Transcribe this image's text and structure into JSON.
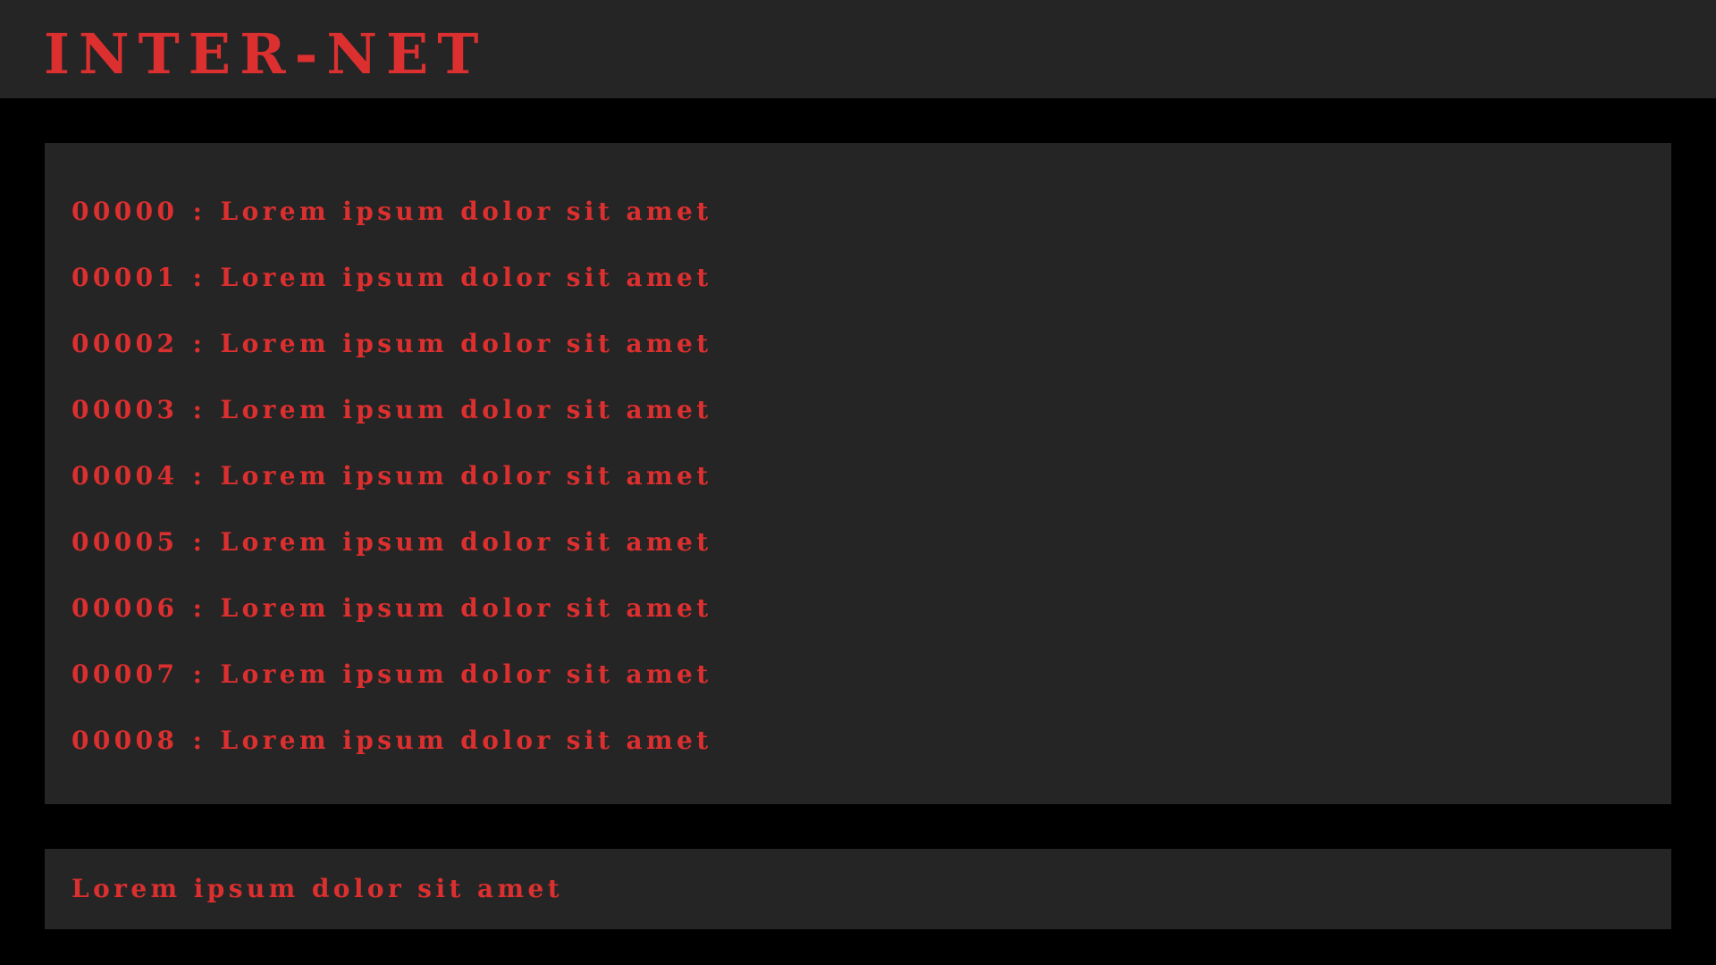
{
  "app": {
    "title": "INTER-NET"
  },
  "colors": {
    "accent": "#dc2f2f",
    "panel": "#252525",
    "background": "#000000"
  },
  "log": {
    "separator": ":",
    "entries": [
      {
        "id": "00000",
        "text": "Lorem ipsum dolor sit amet"
      },
      {
        "id": "00001",
        "text": "Lorem ipsum dolor sit amet"
      },
      {
        "id": "00002",
        "text": "Lorem ipsum dolor sit amet"
      },
      {
        "id": "00003",
        "text": "Lorem ipsum dolor sit amet"
      },
      {
        "id": "00004",
        "text": "Lorem ipsum dolor sit amet"
      },
      {
        "id": "00005",
        "text": "Lorem ipsum dolor sit amet"
      },
      {
        "id": "00006",
        "text": "Lorem ipsum dolor sit amet"
      },
      {
        "id": "00007",
        "text": "Lorem ipsum dolor sit amet"
      },
      {
        "id": "00008",
        "text": "Lorem ipsum dolor sit amet"
      }
    ]
  },
  "input_bar": {
    "value": "Lorem ipsum dolor sit amet"
  }
}
